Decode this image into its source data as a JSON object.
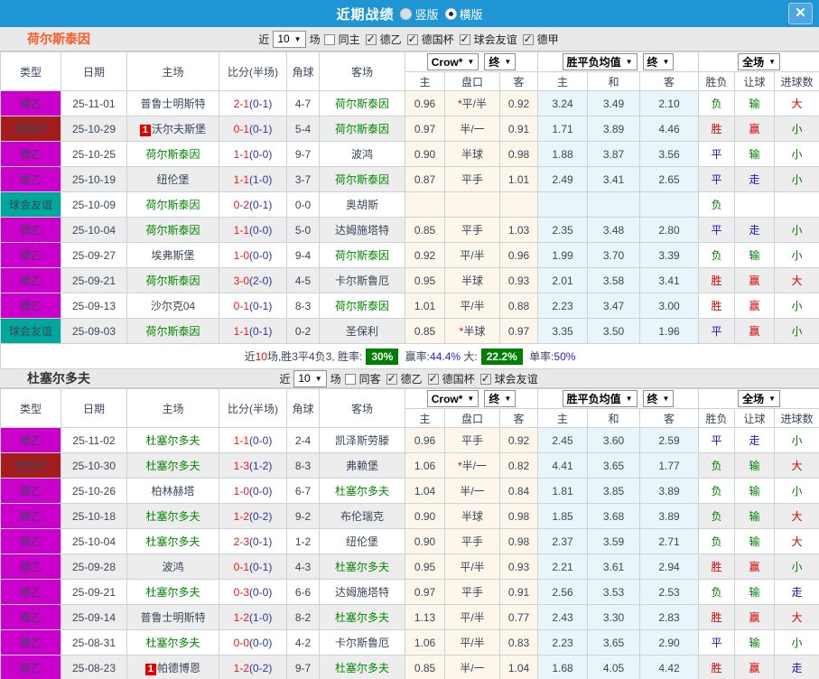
{
  "title_bar": {
    "title": "近期战绩",
    "radio_options": [
      {
        "label": "竖版",
        "selected": false
      },
      {
        "label": "横版",
        "selected": true
      }
    ]
  },
  "icons": {
    "close": "✕",
    "dropdown_arrow": "▼",
    "check": "✓"
  },
  "columns": {
    "main": [
      "类型",
      "日期",
      "主场",
      "比分(半场)",
      "角球",
      "客场"
    ],
    "sub": [
      "主",
      "盘口",
      "客",
      "主",
      "和",
      "客",
      "胜负",
      "让球",
      "进球数"
    ],
    "dropdowns": [
      "Crow*",
      "终",
      "胜平负均值",
      "终",
      "全场"
    ]
  },
  "league_colors": {
    "德乙": "#cc00cc",
    "德国杯": "#a51c1c",
    "球会友谊": "#00a79d"
  },
  "result_colors": {
    "胜": "#d80000",
    "赢": "#d80000",
    "大": "#d80000",
    "平": "#1414d8",
    "走": "#1414d8",
    "负": "#008000",
    "输": "#008000",
    "小": "#008000"
  },
  "sections": [
    {
      "team": "荷尔斯泰因",
      "team_color": "#ff5a26",
      "filter": {
        "near": "近",
        "count": "10",
        "games": "场",
        "same": {
          "label": "同主",
          "checked": false
        },
        "leagues": [
          {
            "label": "德乙",
            "checked": true
          },
          {
            "label": "德国杯",
            "checked": true
          },
          {
            "label": "球会友谊",
            "checked": true
          },
          {
            "label": "德甲",
            "checked": true
          }
        ]
      },
      "rows": [
        {
          "type": "德乙",
          "date": "25-11-01",
          "home": "普鲁士明斯特",
          "home_badge": "",
          "away": "荷尔斯泰因",
          "away_badge": "",
          "score": "2-1",
          "half": "(0-1)",
          "corner": "4-7",
          "odds": [
            "0.96",
            "*平/半",
            "0.92"
          ],
          "avg": [
            "3.24",
            "3.49",
            "2.10"
          ],
          "results": [
            "负",
            "输",
            "大"
          ]
        },
        {
          "type": "德国杯",
          "date": "25-10-29",
          "home": "沃尔夫斯堡",
          "home_badge": "1",
          "away": "荷尔斯泰因",
          "away_badge": "",
          "score": "0-1",
          "half": "(0-1)",
          "corner": "5-4",
          "odds": [
            "0.97",
            "半/一",
            "0.91"
          ],
          "avg": [
            "1.71",
            "3.89",
            "4.46"
          ],
          "results": [
            "胜",
            "赢",
            "小"
          ]
        },
        {
          "type": "德乙",
          "date": "25-10-25",
          "home": "荷尔斯泰因",
          "home_badge": "",
          "away": "波鸿",
          "away_badge": "",
          "score": "1-1",
          "half": "(0-0)",
          "corner": "9-7",
          "odds": [
            "0.90",
            "半球",
            "0.98"
          ],
          "avg": [
            "1.88",
            "3.87",
            "3.56"
          ],
          "results": [
            "平",
            "输",
            "小"
          ]
        },
        {
          "type": "德乙",
          "date": "25-10-19",
          "home": "纽伦堡",
          "home_badge": "",
          "away": "荷尔斯泰因",
          "away_badge": "",
          "score": "1-1",
          "half": "(1-0)",
          "corner": "3-7",
          "odds": [
            "0.87",
            "平手",
            "1.01"
          ],
          "avg": [
            "2.49",
            "3.41",
            "2.65"
          ],
          "results": [
            "平",
            "走",
            "小"
          ]
        },
        {
          "type": "球会友谊",
          "date": "25-10-09",
          "home": "荷尔斯泰因",
          "home_badge": "",
          "away": "奥胡斯",
          "away_badge": "",
          "score": "0-2",
          "half": "(0-1)",
          "corner": "0-0",
          "odds": [
            "",
            "",
            ""
          ],
          "avg": [
            "",
            "",
            ""
          ],
          "results": [
            "负",
            "",
            ""
          ]
        },
        {
          "type": "德乙",
          "date": "25-10-04",
          "home": "荷尔斯泰因",
          "home_badge": "",
          "away": "达姆施塔特",
          "away_badge": "",
          "score": "1-1",
          "half": "(0-0)",
          "corner": "5-0",
          "odds": [
            "0.85",
            "平手",
            "1.03"
          ],
          "avg": [
            "2.35",
            "3.48",
            "2.80"
          ],
          "results": [
            "平",
            "走",
            "小"
          ]
        },
        {
          "type": "德乙",
          "date": "25-09-27",
          "home": "埃弗斯堡",
          "home_badge": "",
          "away": "荷尔斯泰因",
          "away_badge": "",
          "score": "1-0",
          "half": "(0-0)",
          "corner": "9-4",
          "odds": [
            "0.92",
            "平/半",
            "0.96"
          ],
          "avg": [
            "1.99",
            "3.70",
            "3.39"
          ],
          "results": [
            "负",
            "输",
            "小"
          ]
        },
        {
          "type": "德乙",
          "date": "25-09-21",
          "home": "荷尔斯泰因",
          "home_badge": "",
          "away": "卡尔斯鲁厄",
          "away_badge": "",
          "score": "3-0",
          "half": "(2-0)",
          "corner": "4-5",
          "odds": [
            "0.95",
            "半球",
            "0.93"
          ],
          "avg": [
            "2.01",
            "3.58",
            "3.41"
          ],
          "results": [
            "胜",
            "赢",
            "大"
          ]
        },
        {
          "type": "德乙",
          "date": "25-09-13",
          "home": "沙尔克04",
          "home_badge": "",
          "away": "荷尔斯泰因",
          "away_badge": "",
          "score": "0-1",
          "half": "(0-1)",
          "corner": "8-3",
          "odds": [
            "1.01",
            "平/半",
            "0.88"
          ],
          "avg": [
            "2.23",
            "3.47",
            "3.00"
          ],
          "results": [
            "胜",
            "赢",
            "小"
          ]
        },
        {
          "type": "球会友谊",
          "date": "25-09-03",
          "home": "荷尔斯泰因",
          "home_badge": "",
          "away": "圣保利",
          "away_badge": "",
          "score": "1-1",
          "half": "(0-1)",
          "corner": "0-2",
          "odds": [
            "0.85",
            "*半球",
            "0.97"
          ],
          "avg": [
            "3.35",
            "3.50",
            "1.96"
          ],
          "results": [
            "平",
            "赢",
            "小"
          ]
        }
      ],
      "summary": {
        "parts": [
          {
            "t": "近",
            "s": "plain"
          },
          {
            "t": "10",
            "s": "red"
          },
          {
            "t": "场,胜3平4负3, 胜率:",
            "s": "plain"
          },
          {
            "t": "30%",
            "s": "badge"
          },
          {
            "t": " 赢率:",
            "s": "plain"
          },
          {
            "t": "44.4%",
            "s": "blue"
          },
          {
            "t": " 大:",
            "s": "plain"
          },
          {
            "t": "22.2%",
            "s": "badge"
          },
          {
            "t": " 单率:",
            "s": "plain"
          },
          {
            "t": "50%",
            "s": "blue"
          }
        ]
      }
    },
    {
      "team": "杜塞尔多夫",
      "team_color": "#333333",
      "filter": {
        "near": "近",
        "count": "10",
        "games": "场",
        "same": {
          "label": "同客",
          "checked": false
        },
        "leagues": [
          {
            "label": "德乙",
            "checked": true
          },
          {
            "label": "德国杯",
            "checked": true
          },
          {
            "label": "球会友谊",
            "checked": true
          }
        ]
      },
      "rows": [
        {
          "type": "德乙",
          "date": "25-11-02",
          "home": "杜塞尔多夫",
          "home_badge": "",
          "away": "凯泽斯劳滕",
          "away_badge": "",
          "score": "1-1",
          "half": "(0-0)",
          "corner": "2-4",
          "odds": [
            "0.96",
            "平手",
            "0.92"
          ],
          "avg": [
            "2.45",
            "3.60",
            "2.59"
          ],
          "results": [
            "平",
            "走",
            "小"
          ]
        },
        {
          "type": "德国杯",
          "date": "25-10-30",
          "home": "杜塞尔多夫",
          "home_badge": "",
          "away": "弗赖堡",
          "away_badge": "",
          "score": "1-3",
          "half": "(1-2)",
          "corner": "8-3",
          "odds": [
            "1.06",
            "*半/一",
            "0.82"
          ],
          "avg": [
            "4.41",
            "3.65",
            "1.77"
          ],
          "results": [
            "负",
            "输",
            "大"
          ]
        },
        {
          "type": "德乙",
          "date": "25-10-26",
          "home": "柏林赫塔",
          "home_badge": "",
          "away": "杜塞尔多夫",
          "away_badge": "",
          "score": "1-0",
          "half": "(0-0)",
          "corner": "6-7",
          "odds": [
            "1.04",
            "半/一",
            "0.84"
          ],
          "avg": [
            "1.81",
            "3.85",
            "3.89"
          ],
          "results": [
            "负",
            "输",
            "小"
          ]
        },
        {
          "type": "德乙",
          "date": "25-10-18",
          "home": "杜塞尔多夫",
          "home_badge": "",
          "away": "布伦瑞克",
          "away_badge": "",
          "score": "1-2",
          "half": "(0-2)",
          "corner": "9-2",
          "odds": [
            "0.90",
            "半球",
            "0.98"
          ],
          "avg": [
            "1.85",
            "3.68",
            "3.89"
          ],
          "results": [
            "负",
            "输",
            "大"
          ]
        },
        {
          "type": "德乙",
          "date": "25-10-04",
          "home": "杜塞尔多夫",
          "home_badge": "",
          "away": "纽伦堡",
          "away_badge": "",
          "score": "2-3",
          "half": "(0-1)",
          "corner": "1-2",
          "odds": [
            "0.90",
            "平手",
            "0.98"
          ],
          "avg": [
            "2.37",
            "3.59",
            "2.71"
          ],
          "results": [
            "负",
            "输",
            "大"
          ]
        },
        {
          "type": "德乙",
          "date": "25-09-28",
          "home": "波鸿",
          "home_badge": "",
          "away": "杜塞尔多夫",
          "away_badge": "",
          "score": "0-1",
          "half": "(0-1)",
          "corner": "4-3",
          "odds": [
            "0.95",
            "平/半",
            "0.93"
          ],
          "avg": [
            "2.21",
            "3.61",
            "2.94"
          ],
          "results": [
            "胜",
            "赢",
            "小"
          ]
        },
        {
          "type": "德乙",
          "date": "25-09-21",
          "home": "杜塞尔多夫",
          "home_badge": "",
          "away": "达姆施塔特",
          "away_badge": "",
          "score": "0-3",
          "half": "(0-0)",
          "corner": "6-6",
          "odds": [
            "0.97",
            "平手",
            "0.91"
          ],
          "avg": [
            "2.56",
            "3.53",
            "2.53"
          ],
          "results": [
            "负",
            "输",
            "走"
          ]
        },
        {
          "type": "德乙",
          "date": "25-09-14",
          "home": "普鲁士明斯特",
          "home_badge": "",
          "away": "杜塞尔多夫",
          "away_badge": "",
          "score": "1-2",
          "half": "(1-0)",
          "corner": "8-2",
          "odds": [
            "1.13",
            "平/半",
            "0.77"
          ],
          "avg": [
            "2.43",
            "3.30",
            "2.83"
          ],
          "results": [
            "胜",
            "赢",
            "大"
          ]
        },
        {
          "type": "德乙",
          "date": "25-08-31",
          "home": "杜塞尔多夫",
          "home_badge": "",
          "away": "卡尔斯鲁厄",
          "away_badge": "",
          "score": "0-0",
          "half": "(0-0)",
          "corner": "4-2",
          "odds": [
            "1.06",
            "平/半",
            "0.83"
          ],
          "avg": [
            "2.23",
            "3.65",
            "2.90"
          ],
          "results": [
            "平",
            "输",
            "小"
          ]
        },
        {
          "type": "德乙",
          "date": "25-08-23",
          "home": "帕德博恩",
          "home_badge": "1",
          "away": "杜塞尔多夫",
          "away_badge": "",
          "score": "1-2",
          "half": "(0-2)",
          "corner": "9-7",
          "odds": [
            "0.85",
            "半/一",
            "1.04"
          ],
          "avg": [
            "1.68",
            "4.05",
            "4.42"
          ],
          "results": [
            "胜",
            "赢",
            "走"
          ]
        }
      ],
      "summary": null
    }
  ]
}
